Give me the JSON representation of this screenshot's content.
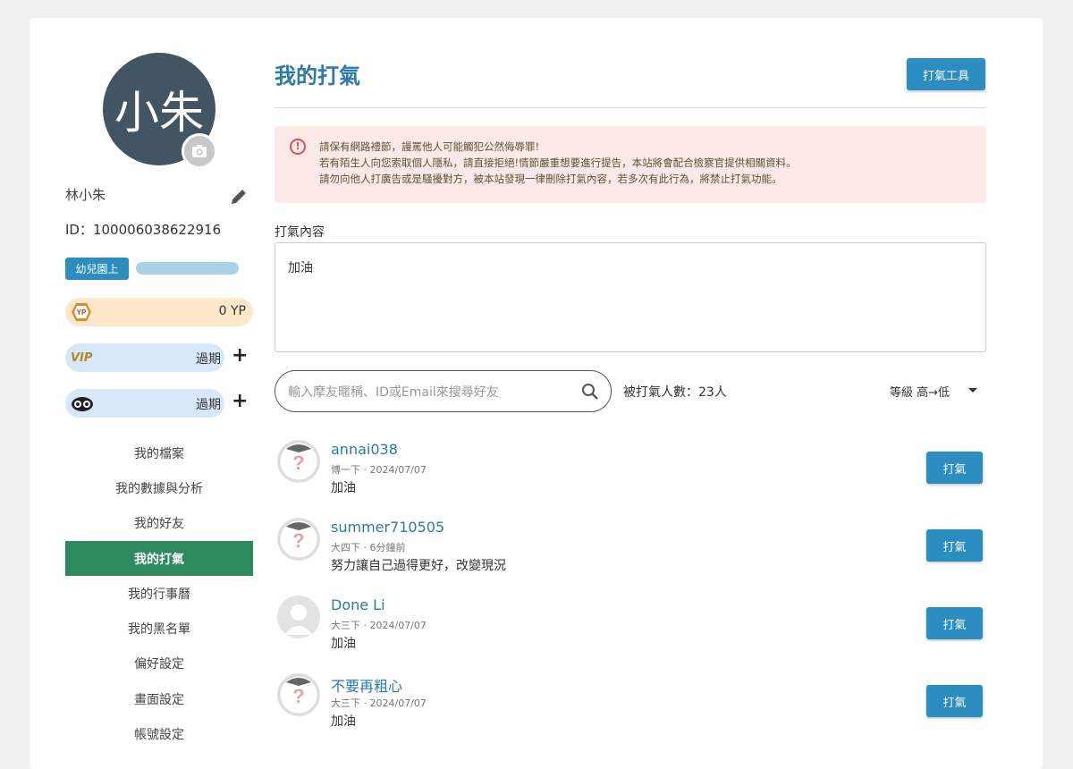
{
  "user": {
    "avatar_text": "小朱",
    "name": "林小朱",
    "id_text": "ID：100006038622916",
    "level": "幼兒園上",
    "yp": "0 YP",
    "vip_label": "VIP",
    "vip_status": "過期",
    "owl_status": "過期",
    "yp_badge": "YP"
  },
  "menu": [
    {
      "label": "我的檔案"
    },
    {
      "label": "我的數據與分析"
    },
    {
      "label": "我的好友"
    },
    {
      "label": "我的打氣"
    },
    {
      "label": "我的行事曆"
    },
    {
      "label": "我的黑名單"
    },
    {
      "label": "偏好設定"
    },
    {
      "label": "畫面設定"
    },
    {
      "label": "帳號設定"
    }
  ],
  "main": {
    "title": "我的打氣",
    "tool_button": "打氣工具",
    "alert_lines": [
      "請保有網路禮節，謾罵他人可能觸犯公然侮辱罪!",
      "若有陌生人向您索取個人隱私，請直接拒絕!情節嚴重想要進行提告，本站將會配合檢察官提供相關資料。",
      "請勿向他人打廣告或是騷擾對方，被本站發現一律刪除打氣內容，若多次有此行為，將禁止打氣功能。"
    ],
    "content_label": "打氣內容",
    "content_value": "加油",
    "search_placeholder": "輸入摩友暱稱、ID或Email來搜尋好友",
    "count_text": "被打氣人數：23人",
    "sort_text": "等級 高→低"
  },
  "cheers": [
    {
      "name": "annai038",
      "meta": "博一下 · 2024/07/07",
      "msg": "加油",
      "button": "打氣"
    },
    {
      "name": "summer710505",
      "meta": "大四下 · 6分鐘前",
      "msg": "努力讓自己過得更好，改變現況",
      "button": "打氣"
    },
    {
      "name": "Done Li",
      "meta": "大三下 · 2024/07/07",
      "msg": "加油",
      "button": "打氣"
    },
    {
      "name": "不要再粗心",
      "meta": "大三下 · 2024/07/07",
      "msg": "加油",
      "button": "打氣"
    }
  ],
  "colors": {
    "accent": "#2b8dc0",
    "active_menu": "#2d8a5f",
    "alert_bg": "#fde9e8"
  }
}
